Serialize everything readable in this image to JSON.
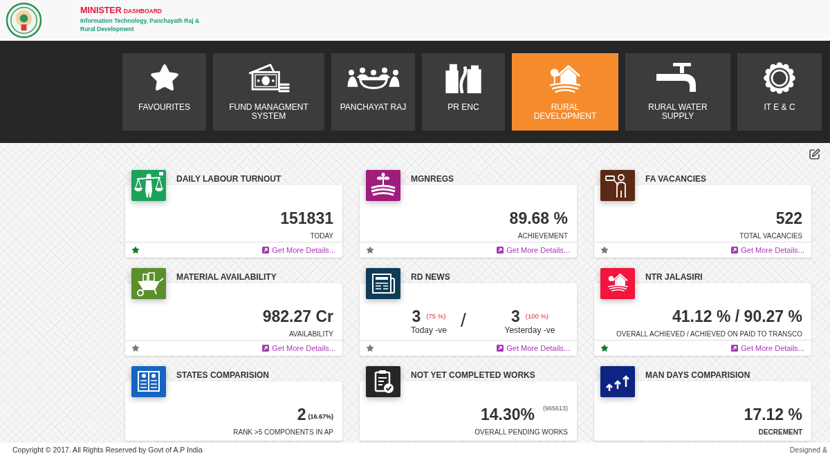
{
  "header": {
    "title": "MINISTER",
    "title_suffix": "DASHBOARD",
    "subtitle_lines": [
      "Information Technology, Panchayath Raj &",
      "Rural Development"
    ]
  },
  "nav": [
    {
      "label": "FAVOURITES",
      "selected": false
    },
    {
      "label": "FUND MANAGMENT SYSTEM",
      "selected": false
    },
    {
      "label": "PANCHAYAT RAJ",
      "selected": false
    },
    {
      "label": "PR ENC",
      "selected": false
    },
    {
      "label": "RURAL DEVELOPMENT",
      "selected": true
    },
    {
      "label": "RURAL WATER SUPPLY",
      "selected": false
    },
    {
      "label": "IT E & C",
      "selected": false
    }
  ],
  "cards": [
    {
      "kind": "single",
      "title": "DAILY LABOUR TURNOUT",
      "color": "#1ba35b",
      "value": "151831",
      "label": "TODAY",
      "label_bold": false,
      "favourite": true,
      "link": "Get More Details..."
    },
    {
      "kind": "single",
      "title": "MGNREGS",
      "color": "#a01c7d",
      "value": "89.68 %",
      "label": "ACHIEVEMENT",
      "label_bold": false,
      "favourite": false,
      "link": "Get More Details..."
    },
    {
      "kind": "single",
      "title": "FA VACANCIES",
      "color": "#5b2914",
      "value": "522",
      "label": "TOTAL VACANCIES",
      "label_bold": false,
      "favourite": false,
      "link": "Get More Details..."
    },
    {
      "kind": "single",
      "title": "MATERIAL AVAILABILITY",
      "color": "#5b8f2b",
      "value": "982.27 Cr",
      "label": "AVAILABILITY",
      "label_bold": false,
      "favourite": false,
      "link": "Get More Details..."
    },
    {
      "kind": "split",
      "title": "RD NEWS",
      "color": "#0d3d56",
      "parts": [
        {
          "value": "3",
          "note": "(75 %)",
          "label": "Today -ve"
        },
        {
          "value": "3",
          "note": "(100 %)",
          "label": "Yesterday -ve"
        }
      ],
      "separator": "/",
      "favourite": false,
      "link": "Get More Details..."
    },
    {
      "kind": "single",
      "title": "NTR JALASIRI",
      "color": "#f2153d",
      "value": "41.12 % / 90.27 %",
      "label": "OVERALL ACHIEVED / ACHIEVED ON PAID TO TRANSCO",
      "label_bold": false,
      "favourite": true,
      "link": "Get More Details..."
    },
    {
      "kind": "single",
      "title": "STATES COMPARISION",
      "color": "#1565c0",
      "value": "2",
      "note": {
        "kind": "inline",
        "text": "(16.67%)"
      },
      "label": "RANK >5 COMPONENTS IN AP",
      "label_bold": false
    },
    {
      "kind": "single",
      "title": "NOT YET COMPLETED WORKS",
      "color": "#262626",
      "value": "14.30%",
      "note": {
        "kind": "raised",
        "text": "(965613)"
      },
      "label": "OVERALL PENDING WORKS",
      "label_bold": false
    },
    {
      "kind": "single",
      "title": "MAN DAYS COMPARISION",
      "color": "#0d2483",
      "value": "17.12 %",
      "label": "DECREMENT",
      "label_bold": true
    }
  ],
  "footer": {
    "copyright": "Copyright © 2017. All Rights Reserved by Govt of A.P India",
    "credit": "Designed &"
  }
}
